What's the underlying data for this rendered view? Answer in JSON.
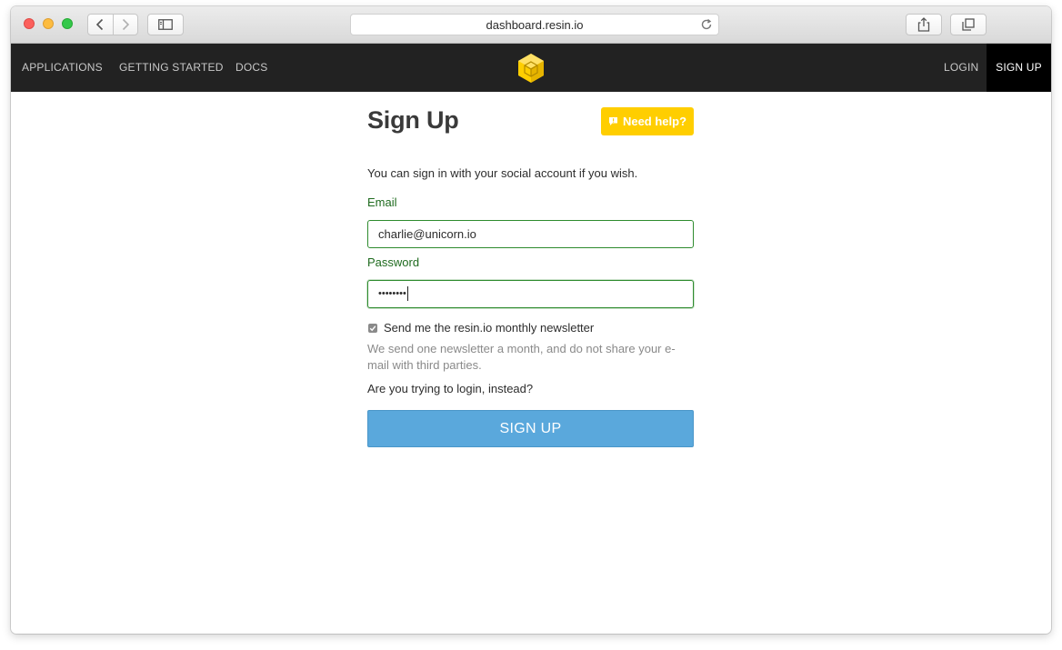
{
  "browser": {
    "url": "dashboard.resin.io"
  },
  "nav": {
    "applications": "APPLICATIONS",
    "getting_started": "GETTING STARTED",
    "docs": "DOCS",
    "login": "LOGIN",
    "signup": "SIGN UP"
  },
  "form": {
    "title": "Sign Up",
    "help_label": "Need help?",
    "intro": "You can sign in with your social account if you wish.",
    "email_label": "Email",
    "email_value": "charlie@unicorn.io",
    "password_label": "Password",
    "password_value": "••••••••",
    "newsletter_label": "Send me the resin.io monthly newsletter",
    "newsletter_checked": true,
    "newsletter_note": "We send one newsletter a month, and do not share your e-mail with third parties.",
    "login_instead": "Are you trying to login, instead?",
    "submit_label": "SIGN UP"
  },
  "colors": {
    "accent_yellow": "#ffce00",
    "button_blue": "#5aa8dc",
    "valid_green": "#2e8b2e",
    "nav_dark": "#222222"
  },
  "icons": {
    "logo": "resin-cube-logo",
    "help": "speech-bubble-exclamation-icon",
    "reload": "reload-icon",
    "back": "chevron-left-icon",
    "forward": "chevron-right-icon",
    "sidebar": "sidebar-icon",
    "share": "share-icon",
    "tabs": "tabs-icon"
  }
}
